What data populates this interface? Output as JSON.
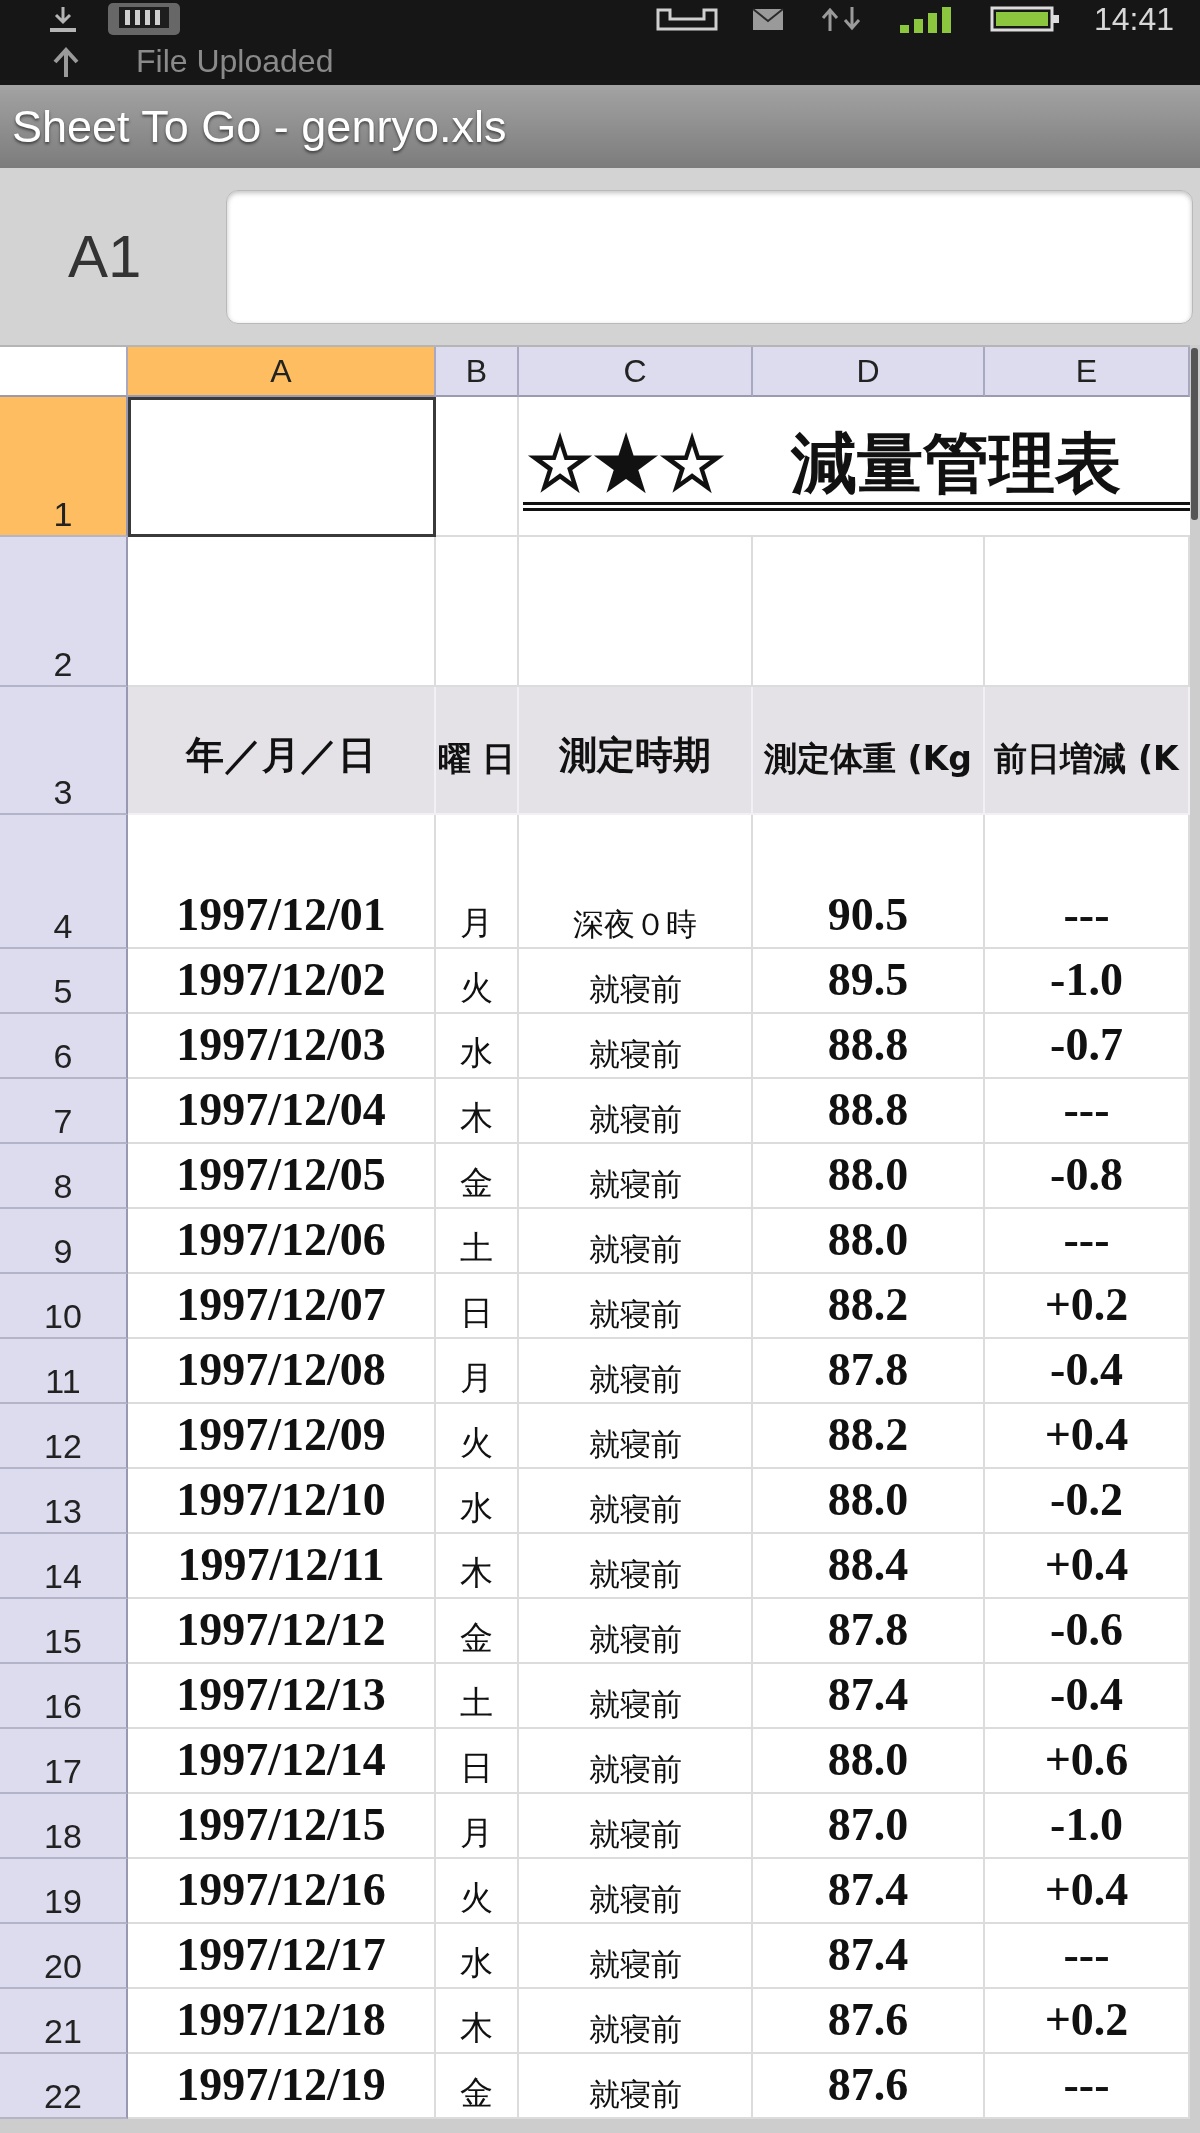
{
  "status_bar": {
    "time": "14:41",
    "notification": "File Uploaded"
  },
  "window": {
    "title": "Sheet To Go - genryo.xls"
  },
  "formula_bar": {
    "cell_reference": "A1"
  },
  "sheet": {
    "columns": [
      {
        "label": "A",
        "selected": true
      },
      {
        "label": "B",
        "selected": false
      },
      {
        "label": "C",
        "selected": false
      },
      {
        "label": "D",
        "selected": false
      },
      {
        "label": "E",
        "selected": false
      }
    ],
    "rows": [
      {
        "number": "1",
        "selected": true,
        "kind": "title",
        "title": "☆★☆　減量管理表"
      },
      {
        "number": "2",
        "selected": false,
        "kind": "blank"
      },
      {
        "number": "3",
        "selected": false,
        "kind": "header",
        "cells": [
          "年／月／日",
          "曜 日",
          "測定時期",
          "測定体重 (Kg",
          "前日増減 (K"
        ]
      },
      {
        "number": "4",
        "selected": false,
        "kind": "data",
        "cells": [
          "1997/12/01",
          "月",
          "深夜０時",
          "90.5",
          "---"
        ]
      },
      {
        "number": "5",
        "selected": false,
        "kind": "data",
        "cells": [
          "1997/12/02",
          "火",
          "就寝前",
          "89.5",
          "-1.0"
        ]
      },
      {
        "number": "6",
        "selected": false,
        "kind": "data",
        "cells": [
          "1997/12/03",
          "水",
          "就寝前",
          "88.8",
          "-0.7"
        ]
      },
      {
        "number": "7",
        "selected": false,
        "kind": "data",
        "cells": [
          "1997/12/04",
          "木",
          "就寝前",
          "88.8",
          "---"
        ]
      },
      {
        "number": "8",
        "selected": false,
        "kind": "data",
        "cells": [
          "1997/12/05",
          "金",
          "就寝前",
          "88.0",
          "-0.8"
        ]
      },
      {
        "number": "9",
        "selected": false,
        "kind": "data",
        "cells": [
          "1997/12/06",
          "土",
          "就寝前",
          "88.0",
          "---"
        ]
      },
      {
        "number": "10",
        "selected": false,
        "kind": "data",
        "cells": [
          "1997/12/07",
          "日",
          "就寝前",
          "88.2",
          "+0.2"
        ]
      },
      {
        "number": "11",
        "selected": false,
        "kind": "data",
        "cells": [
          "1997/12/08",
          "月",
          "就寝前",
          "87.8",
          "-0.4"
        ]
      },
      {
        "number": "12",
        "selected": false,
        "kind": "data",
        "cells": [
          "1997/12/09",
          "火",
          "就寝前",
          "88.2",
          "+0.4"
        ]
      },
      {
        "number": "13",
        "selected": false,
        "kind": "data",
        "cells": [
          "1997/12/10",
          "水",
          "就寝前",
          "88.0",
          "-0.2"
        ]
      },
      {
        "number": "14",
        "selected": false,
        "kind": "data",
        "cells": [
          "1997/12/11",
          "木",
          "就寝前",
          "88.4",
          "+0.4"
        ]
      },
      {
        "number": "15",
        "selected": false,
        "kind": "data",
        "cells": [
          "1997/12/12",
          "金",
          "就寝前",
          "87.8",
          "-0.6"
        ]
      },
      {
        "number": "16",
        "selected": false,
        "kind": "data",
        "cells": [
          "1997/12/13",
          "土",
          "就寝前",
          "87.4",
          "-0.4"
        ]
      },
      {
        "number": "17",
        "selected": false,
        "kind": "data",
        "cells": [
          "1997/12/14",
          "日",
          "就寝前",
          "88.0",
          "+0.6"
        ]
      },
      {
        "number": "18",
        "selected": false,
        "kind": "data",
        "cells": [
          "1997/12/15",
          "月",
          "就寝前",
          "87.0",
          "-1.0"
        ]
      },
      {
        "number": "19",
        "selected": false,
        "kind": "data",
        "cells": [
          "1997/12/16",
          "火",
          "就寝前",
          "87.4",
          "+0.4"
        ]
      },
      {
        "number": "20",
        "selected": false,
        "kind": "data",
        "cells": [
          "1997/12/17",
          "水",
          "就寝前",
          "87.4",
          "---"
        ]
      },
      {
        "number": "21",
        "selected": false,
        "kind": "data",
        "cells": [
          "1997/12/18",
          "木",
          "就寝前",
          "87.6",
          "+0.2"
        ]
      },
      {
        "number": "22",
        "selected": false,
        "kind": "data",
        "cells": [
          "1997/12/19",
          "金",
          "就寝前",
          "87.6",
          "---"
        ]
      }
    ]
  }
}
